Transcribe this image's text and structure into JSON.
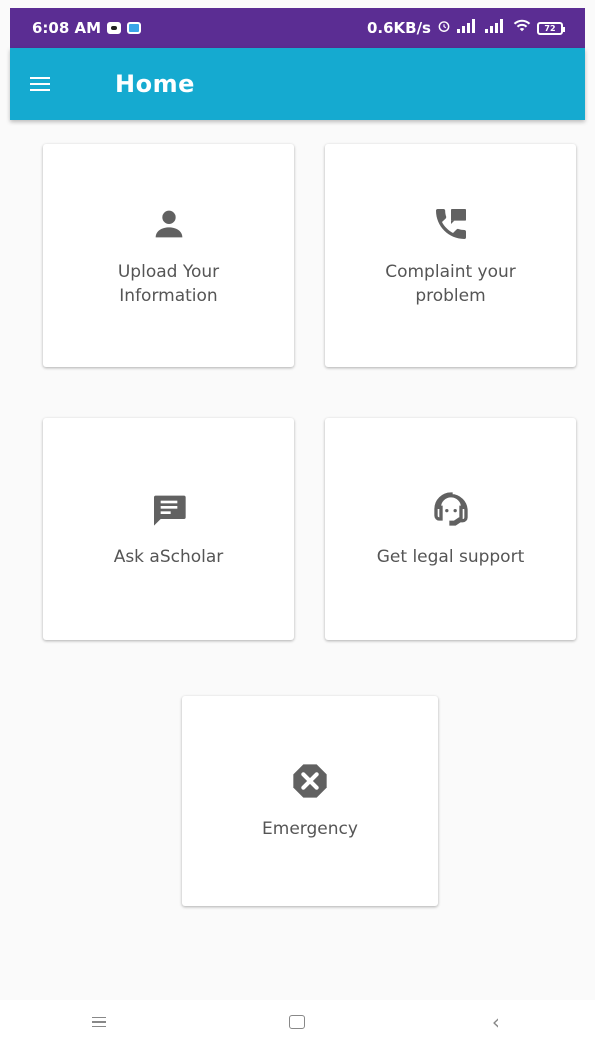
{
  "status_bar": {
    "time": "6:08 AM",
    "network_speed": "0.6KB/s",
    "battery_level": "72",
    "icons": [
      "notification-icon",
      "app-notification-icon",
      "alarm-icon",
      "signal-icon",
      "signal-icon",
      "wifi-icon",
      "battery-icon"
    ]
  },
  "app_bar": {
    "title": "Home",
    "menu_icon": "hamburger-menu-icon",
    "color": "#15aad0"
  },
  "cards": [
    {
      "label": "Upload Your\nInformation",
      "icon": "person-icon"
    },
    {
      "label": "Complaint your\nproblem",
      "icon": "phone-forward-icon"
    },
    {
      "label": "Ask aScholar",
      "icon": "chat-icon"
    },
    {
      "label": "Get legal support",
      "icon": "headset-icon"
    },
    {
      "label": "Emergency",
      "icon": "cancel-icon"
    }
  ],
  "nav_bar": {
    "buttons": [
      "recent-apps-icon",
      "home-icon",
      "back-icon"
    ]
  },
  "colors": {
    "status_bar": "#5b2d93",
    "app_bar": "#15aad0",
    "icon": "#616161",
    "background": "#fafafa"
  }
}
